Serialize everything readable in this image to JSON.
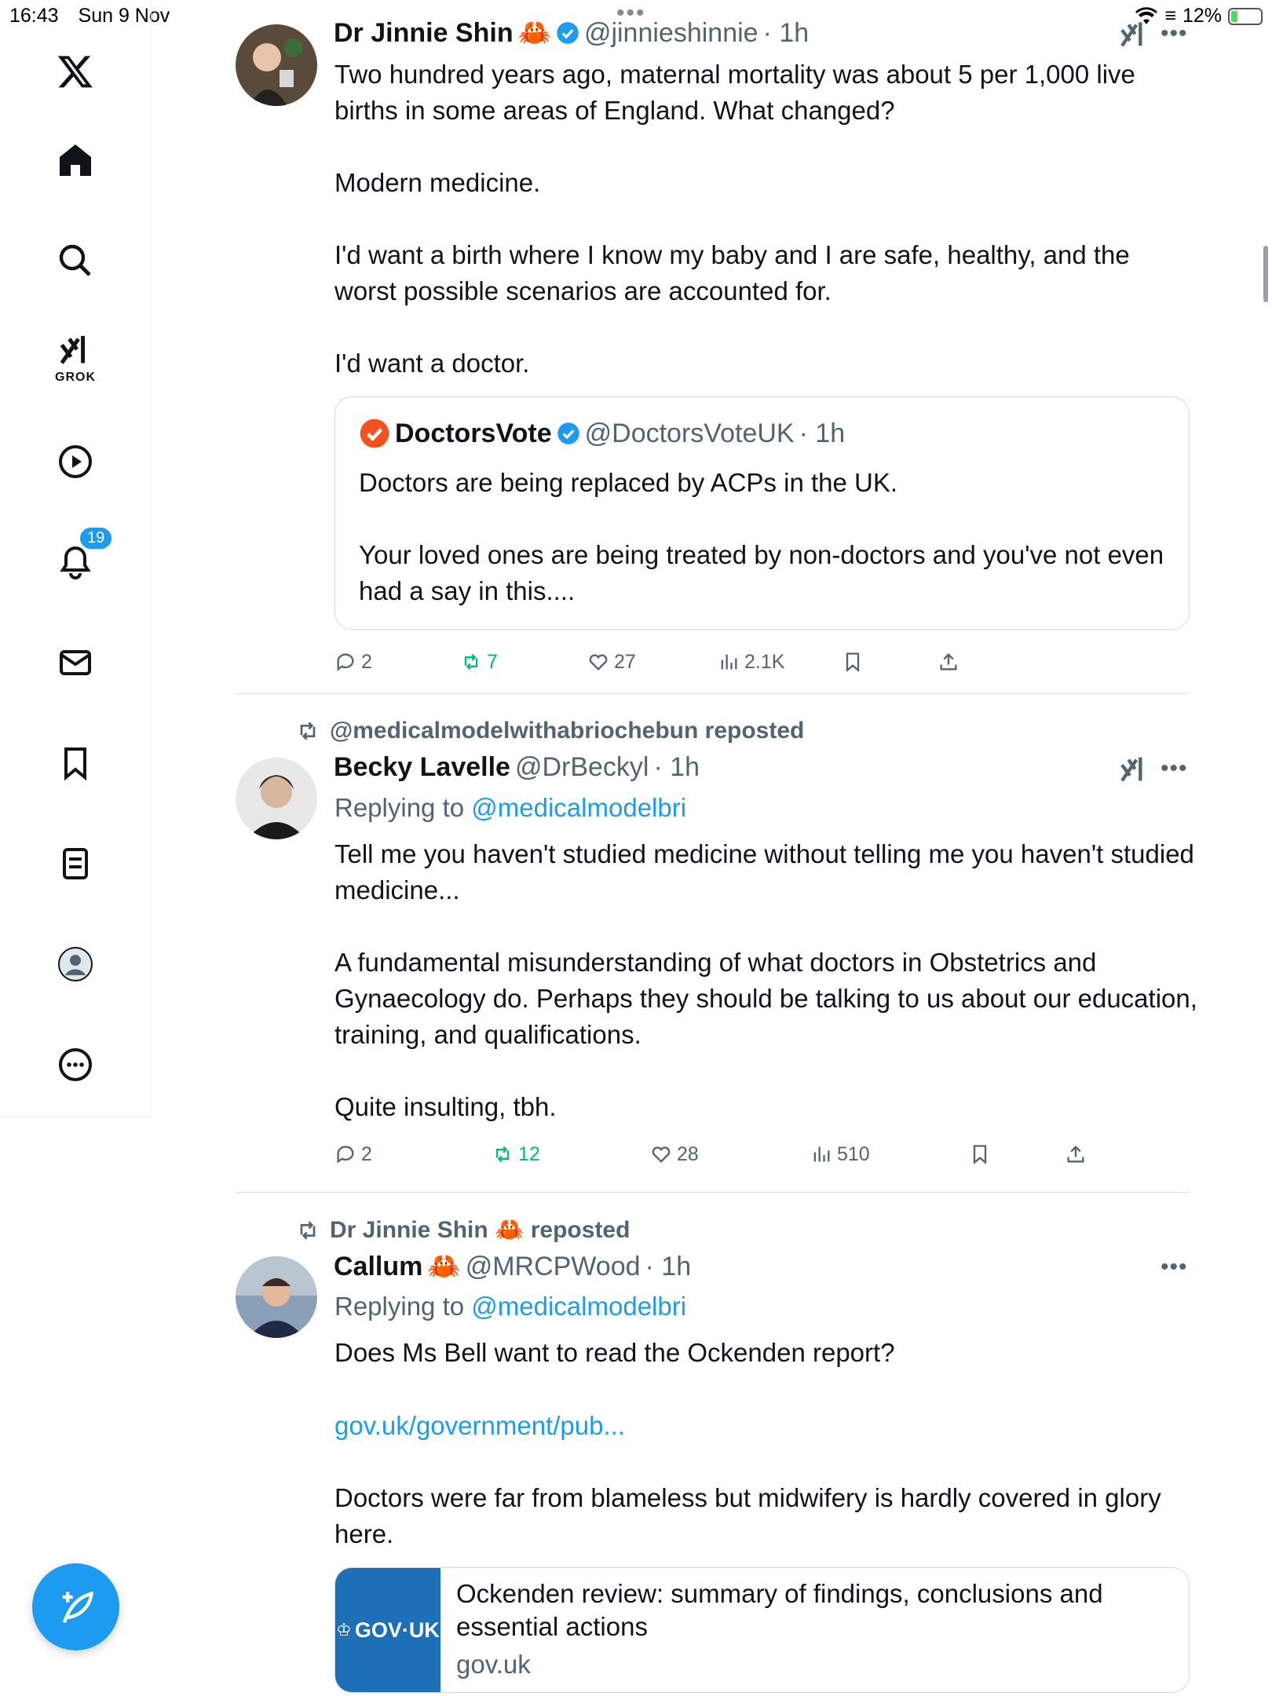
{
  "status_bar": {
    "time": "16:43",
    "date": "Sun 9 Nov",
    "battery": "12%",
    "battery_level": 0.12
  },
  "sidebar": {
    "notification_count": "19",
    "grok_label": "GROK"
  },
  "colors": {
    "accent": "#1d9bf0",
    "repost_green": "#00ba7c",
    "secondary_text": "#536471"
  },
  "tweets": [
    {
      "name": "Dr Jinnie Shin",
      "emoji": "🦀",
      "handle": "@jinnieshinnie",
      "time": "· 1h",
      "body": "Two hundred years ago, maternal mortality was about 5 per 1,000 live births in some areas of England. What changed?\n\nModern medicine.\n\nI'd want a birth where I know my baby and I are safe, healthy, and the worst possible scenarios are accounted for.\n\nI'd want a doctor.",
      "quote": {
        "name": "DoctorsVote",
        "handle": "@DoctorsVoteUK",
        "time": "· 1h",
        "body": "Doctors are being replaced by ACPs in the UK.\n\nYour loved ones are being treated by non-doctors and you've not even had a say in this...."
      },
      "stats": {
        "replies": "2",
        "reposts": "7",
        "likes": "27",
        "views": "2.1K"
      }
    },
    {
      "reposted_by": "@medicalmodelwithabriochebun reposted",
      "name": "Becky Lavelle",
      "handle": "@DrBeckyl",
      "time": "· 1h",
      "replying_prefix": "Replying to",
      "replying_to": "@medicalmodelbri",
      "body": "Tell me you haven't studied medicine without telling me you haven't studied medicine...\n\nA fundamental misunderstanding of what doctors in Obstetrics and Gynaecology do. Perhaps they should be talking to us about our education, training, and qualifications.\n\nQuite insulting, tbh.",
      "stats": {
        "replies": "2",
        "reposts": "12",
        "likes": "28",
        "views": "510"
      }
    },
    {
      "reposted_by_name": "Dr Jinnie Shin",
      "reposted_by_emoji": "🦀",
      "reposted_suffix": "reposted",
      "name": "Callum",
      "emoji": "🦀",
      "handle": "@MRCPWood",
      "time": "· 1h",
      "replying_prefix": "Replying to",
      "replying_to": "@medicalmodelbri",
      "body_1": "Does Ms Bell want to read the Ockenden report?",
      "link": "gov.uk/government/pub...",
      "body_2": "Doctors were far from blameless but midwifery is hardly covered in glory here.",
      "card": {
        "image_text": "GOV·UK",
        "title": "Ockenden review: summary of findings, conclusions and essential actions",
        "domain": "gov.uk"
      }
    }
  ]
}
